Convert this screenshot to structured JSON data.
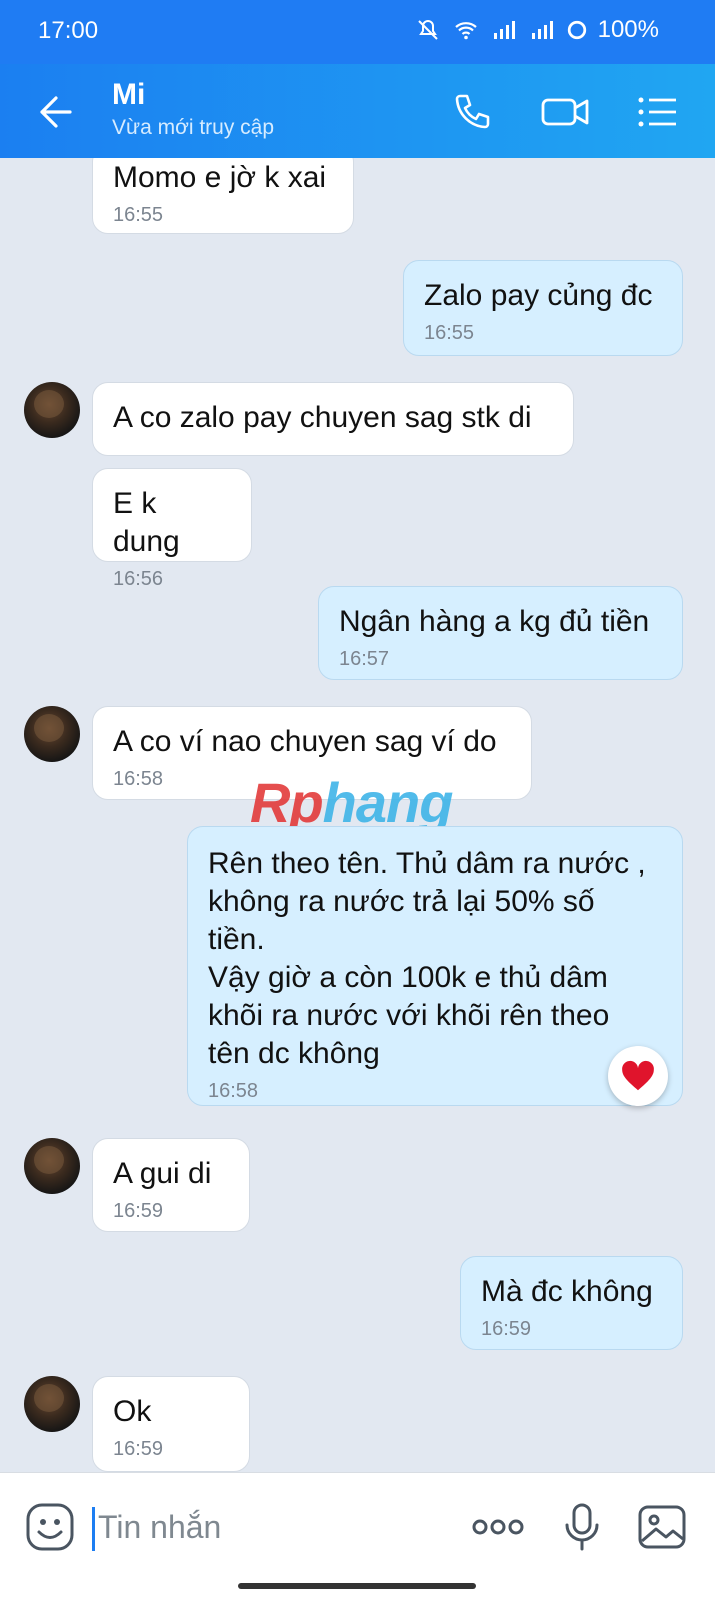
{
  "status_bar": {
    "time": "17:00",
    "battery": "100%"
  },
  "header": {
    "contact_name": "Mi",
    "contact_status": "Vừa mới truy cập"
  },
  "messages": [
    {
      "dir": "in",
      "text": "Momo e jờ k xai",
      "time": "16:55"
    },
    {
      "dir": "out",
      "text": "Zalo pay củng đc",
      "time": "16:55"
    },
    {
      "dir": "in",
      "text": "A co zalo pay chuyen sag stk di",
      "time": ""
    },
    {
      "dir": "in",
      "text": "E k dung",
      "time": "16:56"
    },
    {
      "dir": "out",
      "text": "Ngân hàng a kg đủ tiền",
      "time": "16:57"
    },
    {
      "dir": "in",
      "text": "A co ví nao chuyen sag ví do",
      "time": "16:58"
    },
    {
      "dir": "out",
      "text": "Rên theo tên. Thủ dâm ra nước ,\nkhông ra nước trả lại 50% số\ntiền.\nVậy giờ a còn 100k e thủ dâm\nkhõi ra nước với khõi rên theo\ntên dc không",
      "time": "16:58",
      "reaction": "heart-icon"
    },
    {
      "dir": "in",
      "text": "A gui di",
      "time": "16:59"
    },
    {
      "dir": "out",
      "text": "Mà đc không",
      "time": "16:59"
    },
    {
      "dir": "in",
      "text": "Ok",
      "time": "16:59"
    }
  ],
  "watermark": {
    "part1": "Rp",
    "part2": "hang"
  },
  "input": {
    "placeholder": "Tin nhắn"
  },
  "colors": {
    "header": "#1f7cf3",
    "outgoing_bubble": "#d6efff",
    "incoming_bubble": "#ffffff",
    "background": "#e2e8f1"
  }
}
